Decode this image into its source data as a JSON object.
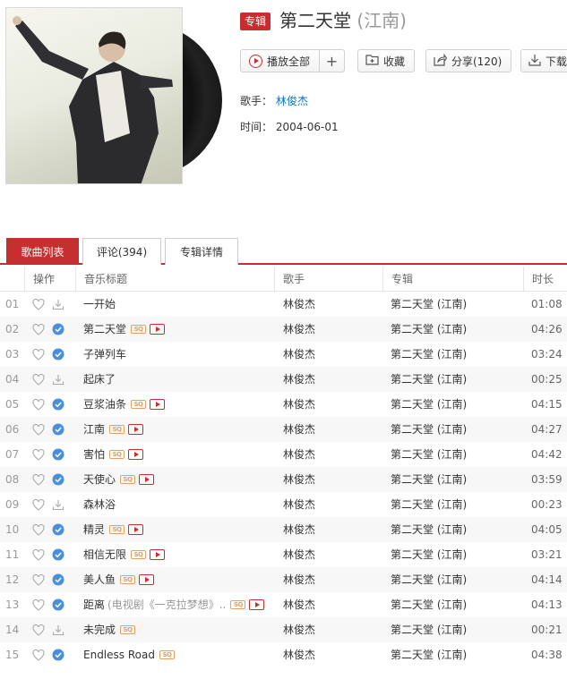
{
  "album": {
    "tag": "专辑",
    "title": "第二天堂",
    "subtitle": "(江南)",
    "artist_label": "歌手：",
    "artist": "林俊杰",
    "time_label": "时间：",
    "time": "2004-06-01"
  },
  "actions": {
    "play_all": "播放全部",
    "add": "+",
    "favorite": "收藏",
    "share": "分享(120)",
    "download": "下载"
  },
  "tabs": [
    {
      "label": "歌曲列表",
      "active": true
    },
    {
      "label": "评论(394)",
      "active": false
    },
    {
      "label": "专辑详情",
      "active": false
    }
  ],
  "table": {
    "headers": [
      "操作",
      "音乐标题",
      "歌手",
      "专辑",
      "时长"
    ],
    "rows": [
      {
        "no": "01",
        "title": "一开始",
        "alias": "",
        "sq": false,
        "mv": false,
        "downloaded": false,
        "artist": "林俊杰",
        "album": "第二天堂 (江南)",
        "duration": "01:08"
      },
      {
        "no": "02",
        "title": "第二天堂",
        "alias": "",
        "sq": true,
        "mv": true,
        "downloaded": true,
        "artist": "林俊杰",
        "album": "第二天堂 (江南)",
        "duration": "04:26"
      },
      {
        "no": "03",
        "title": "子弹列车",
        "alias": "",
        "sq": false,
        "mv": false,
        "downloaded": true,
        "artist": "林俊杰",
        "album": "第二天堂 (江南)",
        "duration": "03:24"
      },
      {
        "no": "04",
        "title": "起床了",
        "alias": "",
        "sq": false,
        "mv": false,
        "downloaded": false,
        "artist": "林俊杰",
        "album": "第二天堂 (江南)",
        "duration": "00:25"
      },
      {
        "no": "05",
        "title": "豆浆油条",
        "alias": "",
        "sq": true,
        "mv": true,
        "downloaded": true,
        "artist": "林俊杰",
        "album": "第二天堂 (江南)",
        "duration": "04:15"
      },
      {
        "no": "06",
        "title": "江南",
        "alias": "",
        "sq": true,
        "mv": true,
        "downloaded": true,
        "artist": "林俊杰",
        "album": "第二天堂 (江南)",
        "duration": "04:27"
      },
      {
        "no": "07",
        "title": "害怕",
        "alias": "",
        "sq": true,
        "mv": true,
        "downloaded": true,
        "artist": "林俊杰",
        "album": "第二天堂 (江南)",
        "duration": "04:42"
      },
      {
        "no": "08",
        "title": "天使心",
        "alias": "",
        "sq": true,
        "mv": true,
        "downloaded": true,
        "artist": "林俊杰",
        "album": "第二天堂 (江南)",
        "duration": "03:59"
      },
      {
        "no": "09",
        "title": "森林浴",
        "alias": "",
        "sq": false,
        "mv": false,
        "downloaded": false,
        "artist": "林俊杰",
        "album": "第二天堂 (江南)",
        "duration": "00:23"
      },
      {
        "no": "10",
        "title": "精灵",
        "alias": "",
        "sq": true,
        "mv": true,
        "downloaded": true,
        "artist": "林俊杰",
        "album": "第二天堂 (江南)",
        "duration": "04:05"
      },
      {
        "no": "11",
        "title": "相信无限",
        "alias": "",
        "sq": true,
        "mv": true,
        "downloaded": true,
        "artist": "林俊杰",
        "album": "第二天堂 (江南)",
        "duration": "03:21"
      },
      {
        "no": "12",
        "title": "美人鱼",
        "alias": "",
        "sq": true,
        "mv": true,
        "downloaded": true,
        "artist": "林俊杰",
        "album": "第二天堂 (江南)",
        "duration": "04:14"
      },
      {
        "no": "13",
        "title": "距离",
        "alias": "(电视剧《一克拉梦想》..",
        "sq": true,
        "mv": true,
        "downloaded": true,
        "artist": "林俊杰",
        "album": "第二天堂 (江南)",
        "duration": "04:13"
      },
      {
        "no": "14",
        "title": "未完成",
        "alias": "",
        "sq": true,
        "mv": false,
        "downloaded": false,
        "artist": "林俊杰",
        "album": "第二天堂 (江南)",
        "duration": "00:21"
      },
      {
        "no": "15",
        "title": "Endless Road",
        "alias": "",
        "sq": true,
        "mv": false,
        "downloaded": true,
        "artist": "林俊杰",
        "album": "第二天堂 (江南)",
        "duration": "04:38"
      }
    ]
  },
  "badges": {
    "sq": "SQ"
  },
  "colors": {
    "accent": "#c62f2f",
    "check": "#4a90d9",
    "sq": "#e4a165"
  }
}
